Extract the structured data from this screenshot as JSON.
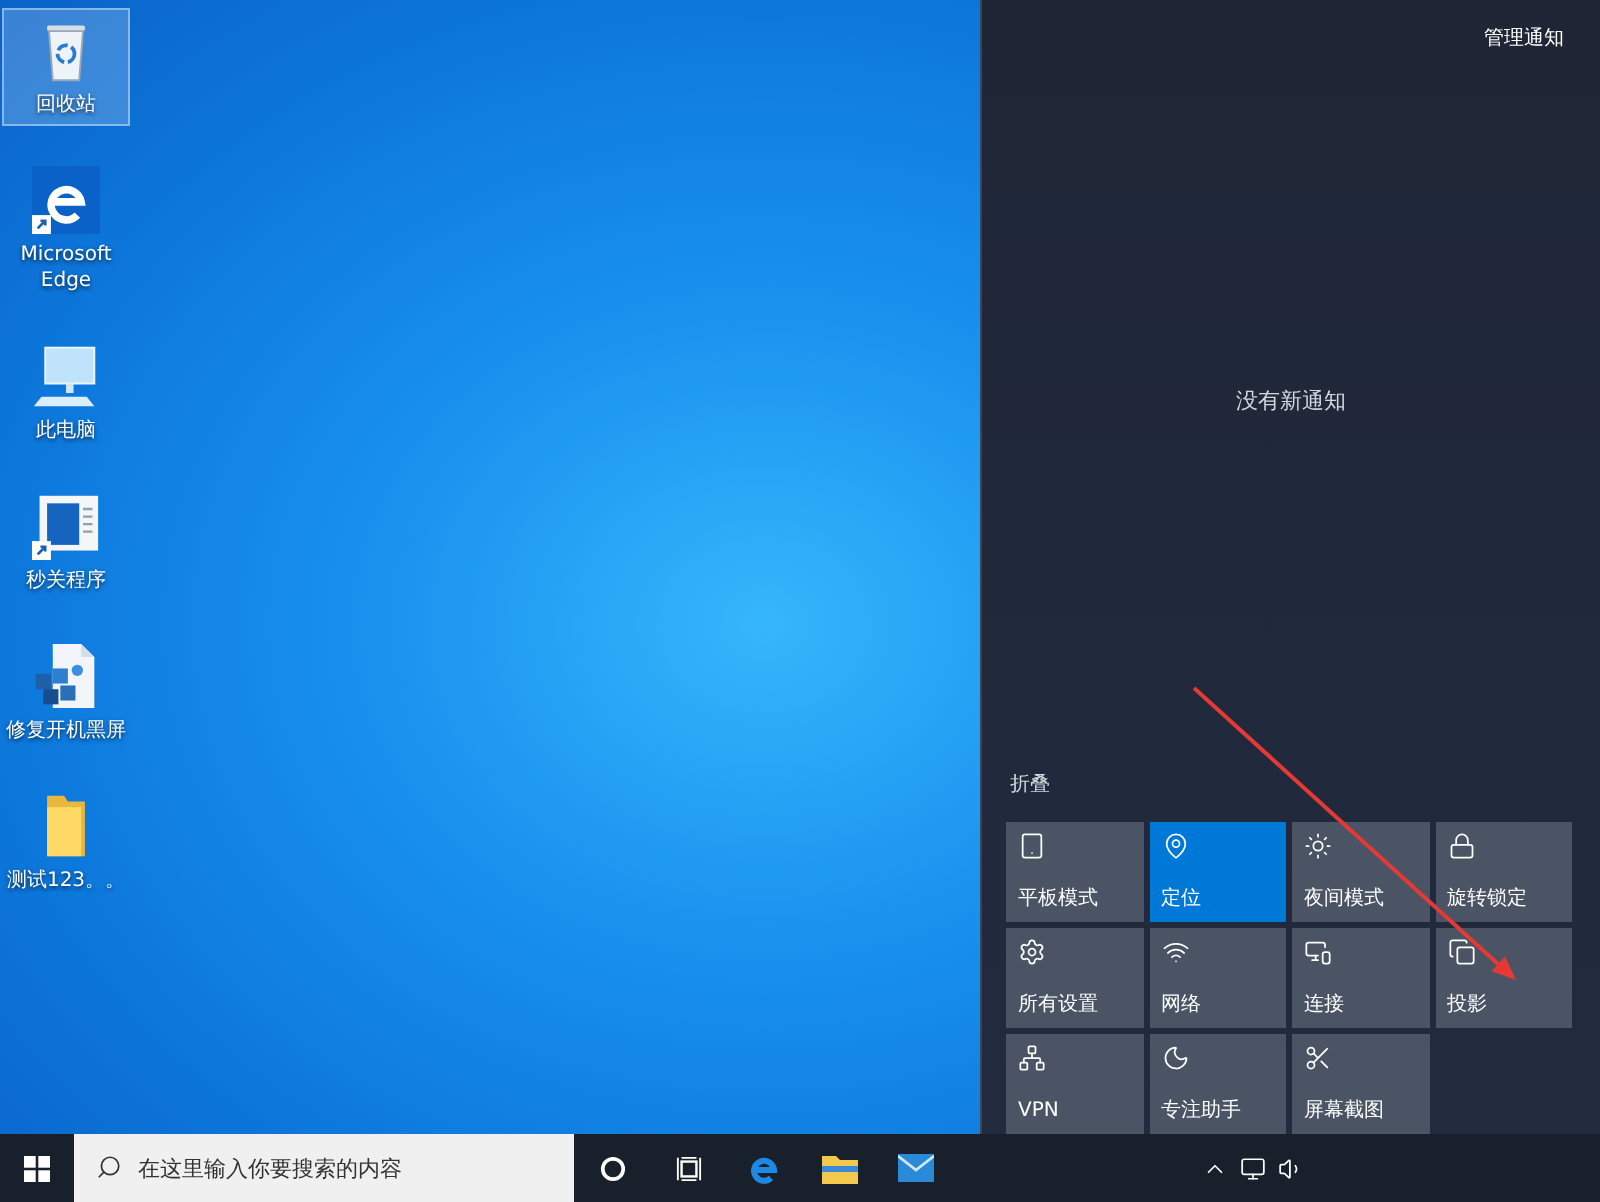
{
  "desktop": {
    "icons": [
      {
        "label": "回收站",
        "selected": true
      },
      {
        "label": "Microsoft Edge",
        "selected": false
      },
      {
        "label": "此电脑",
        "selected": false
      },
      {
        "label": "秒关程序",
        "selected": false
      },
      {
        "label": "修复开机黑屏",
        "selected": false
      },
      {
        "label": "测试123。。",
        "selected": false
      }
    ]
  },
  "action_center": {
    "manage_link": "管理通知",
    "empty_message": "没有新通知",
    "collapse_link": "折叠",
    "quick_actions": [
      {
        "label": "平板模式",
        "on": false
      },
      {
        "label": "定位",
        "on": true
      },
      {
        "label": "夜间模式",
        "on": false
      },
      {
        "label": "旋转锁定",
        "on": false
      },
      {
        "label": "所有设置",
        "on": false
      },
      {
        "label": "网络",
        "on": false
      },
      {
        "label": "连接",
        "on": false
      },
      {
        "label": "投影",
        "on": false
      },
      {
        "label": "VPN",
        "on": false
      },
      {
        "label": "专注助手",
        "on": false
      },
      {
        "label": "屏幕截图",
        "on": false
      }
    ]
  },
  "taskbar": {
    "search": {
      "placeholder": "在这里输入你要搜索的内容"
    }
  }
}
